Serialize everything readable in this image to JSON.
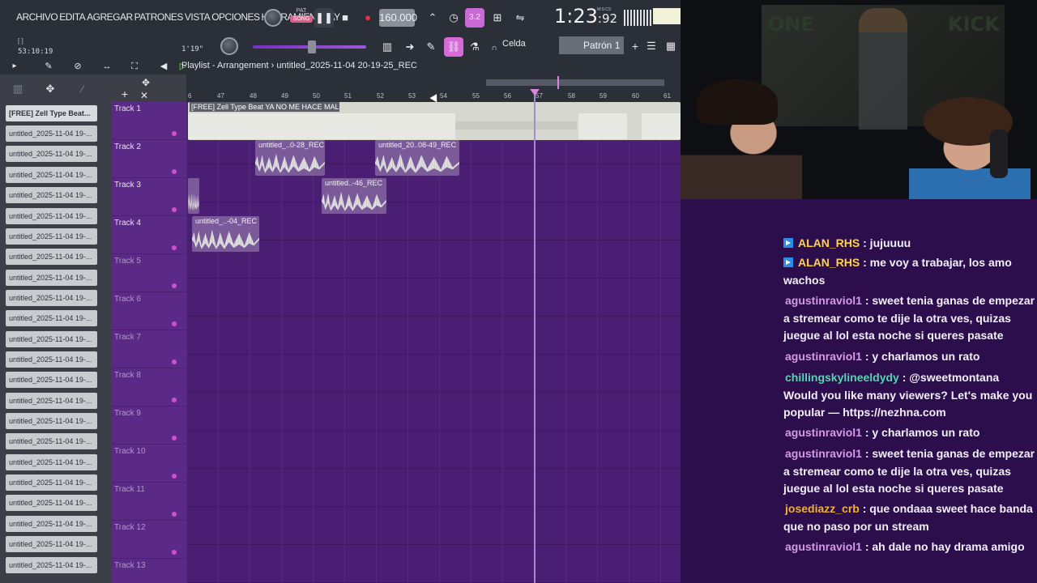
{
  "menu": [
    "ARCHIVO",
    "EDITA",
    "AGREGAR",
    "PATRONES",
    "VISTA",
    "OPCIONES",
    "HERRAMIENTA",
    "AY"
  ],
  "transport": {
    "pat": "PAT",
    "song": "SONG",
    "tempo": "160.000",
    "clock_main": "1:23",
    "clock_sub": ":92",
    "clock_units": "M:S:CS",
    "snap": "3.2"
  },
  "toolbar2": {
    "position": "53:10:19",
    "position_label": "[ ]",
    "time": "1'19\"",
    "snap_mode": "Celda",
    "pattern": "Patrón 1"
  },
  "titlebar": {
    "view": "Playlist - Arrangement",
    "separator": "›",
    "project": "untitled_2025-11-04 20-19-25_REC"
  },
  "ruler": [
    "6",
    "47",
    "48",
    "49",
    "50",
    "51",
    "52",
    "53",
    "54",
    "55",
    "56",
    "57",
    "58",
    "59",
    "60",
    "61"
  ],
  "browser": {
    "items": [
      "[FREE] Zell Type Beat...",
      "untitled_2025-11-04 19-...",
      "untitled_2025-11-04 19-...",
      "untitled_2025-11-04 19-...",
      "untitled_2025-11-04 19-...",
      "untitled_2025-11-04 19-...",
      "untitled_2025-11-04 19-...",
      "untitled_2025-11-04 19-...",
      "untitled_2025-11-04 19-...",
      "untitled_2025-11-04 19-...",
      "untitled_2025-11-04 19-...",
      "untitled_2025-11-04 19-...",
      "untitled_2025-11-04 19-...",
      "untitled_2025-11-04 19-...",
      "untitled_2025-11-04 19-...",
      "untitled_2025-11-04 19-...",
      "untitled_2025-11-04 19-...",
      "untitled_2025-11-04 19-...",
      "untitled_2025-11-04 19-...",
      "untitled_2025-11-04 19-...",
      "untitled_2025-11-04 19-...",
      "untitled_2025-11-04 19-...",
      "untitled_2025-11-04 19-..."
    ]
  },
  "tracks": [
    "Track 1",
    "Track 2",
    "Track 3",
    "Track 4",
    "Track 5",
    "Track 6",
    "Track 7",
    "Track 8",
    "Track 9",
    "Track 10",
    "Track 11",
    "Track 12",
    "Track 13"
  ],
  "clips": {
    "c1": "[FREE] Zell Type Beat  YA NO ME HACE MAL",
    "c2": "untitled_..0-28_REC",
    "c3": "untitled_20..08-49_REC",
    "c4": "untitled..-46_REC",
    "c5": "untitled_..-04_REC",
    "c6": ""
  },
  "webcam": {
    "poster_left": "ONE",
    "poster_right": "KICK"
  },
  "chat": [
    {
      "user": "ALAN_RHS",
      "text": ": jujuuuu",
      "color": "#ffd24a",
      "badge": true
    },
    {
      "user": "ALAN_RHS",
      "text": ": me voy a trabajar, los amo wachos",
      "color": "#ffd24a",
      "badge": true
    },
    {
      "user": "agustinraviol1",
      "text": ": sweet tenia ganas de empezar a stremear como te dije la otra ves, quizas juegue al lol esta noche si queres pasate",
      "color": "#d59ae6",
      "badge": false
    },
    {
      "user": "agustinraviol1",
      "text": ": y charlamos un rato",
      "color": "#d59ae6",
      "badge": false
    },
    {
      "user": "chillingskylineeldydy",
      "text": ": @sweetmontana Would you like many viewers? Let's make you popular — https://nezhna.com",
      "color": "#5ad2b0",
      "badge": false
    },
    {
      "user": "agustinraviol1",
      "text": ": y charlamos un rato",
      "color": "#d59ae6",
      "badge": false
    },
    {
      "user": "agustinraviol1",
      "text": ": sweet tenia ganas de empezar a stremear como te dije la otra ves, quizas juegue al lol esta noche si queres pasate",
      "color": "#d59ae6",
      "badge": false
    },
    {
      "user": "josediazz_crb",
      "text": ": que ondaaa sweet hace banda que no paso por un stream",
      "color": "#f2b134",
      "badge": false
    },
    {
      "user": "agustinraviol1",
      "text": ": ah dale no hay drama amigo",
      "color": "#d59ae6",
      "badge": false
    }
  ]
}
